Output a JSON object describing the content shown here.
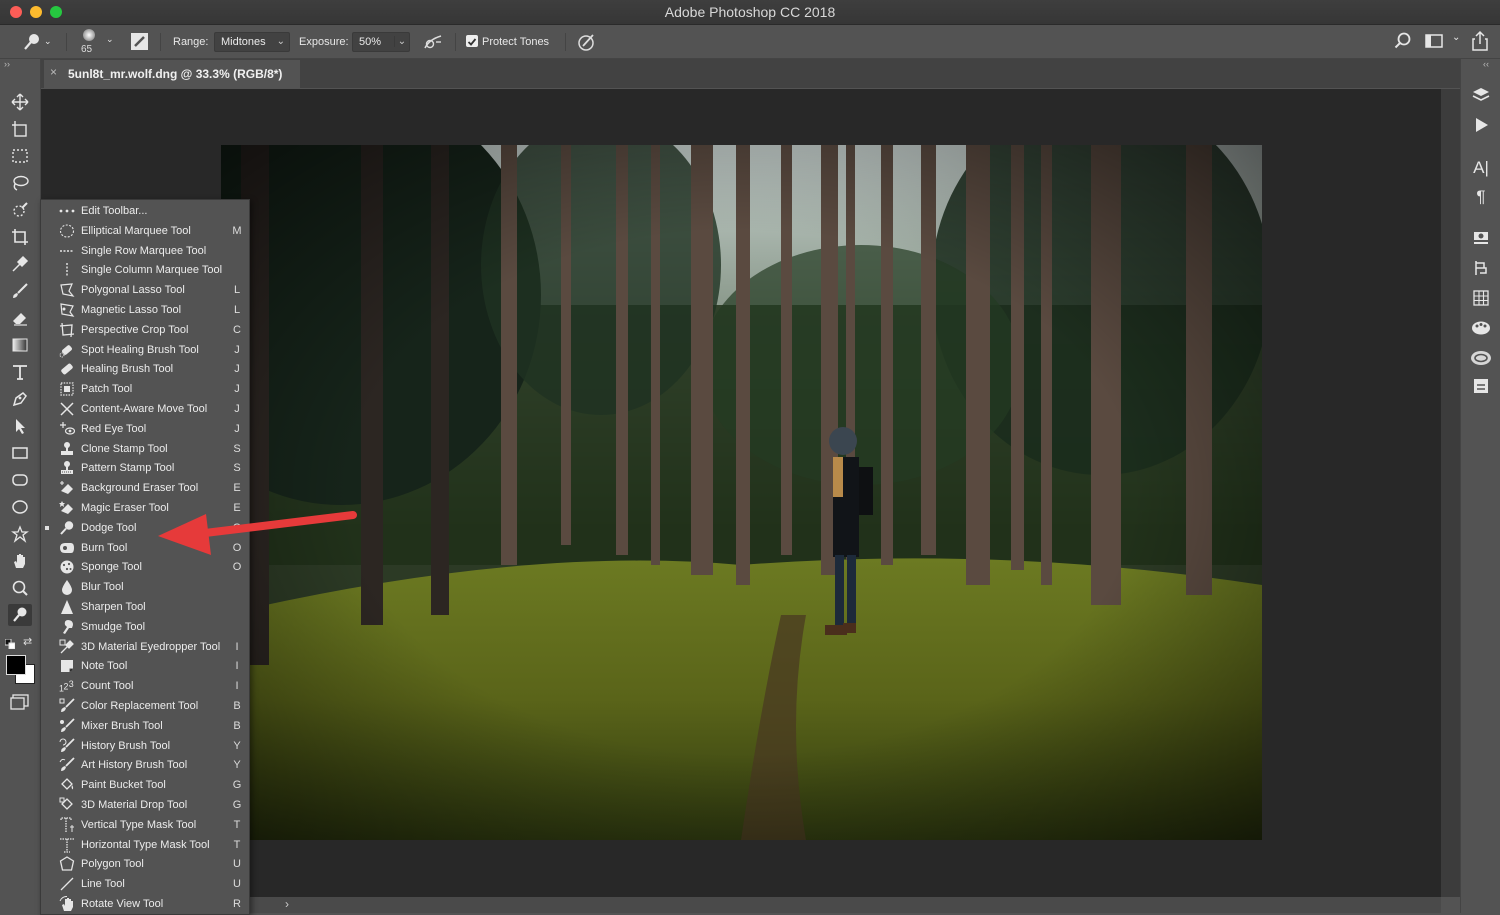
{
  "app": {
    "title": "Adobe Photoshop CC 2018"
  },
  "colors": {
    "traffic_red": "#fc5d57",
    "traffic_yellow": "#fdbb2e",
    "traffic_green": "#26c840",
    "annotation_arrow": "#e63a3a"
  },
  "options_bar": {
    "tool_icon": "dodge-tool-icon",
    "brush_size": "65",
    "range_label": "Range:",
    "range_value": "Midtones",
    "exposure_label": "Exposure:",
    "exposure_value": "50%",
    "protect_tones_label": "Protect Tones",
    "protect_tones_checked": true
  },
  "document": {
    "tab_close": "×",
    "tab_title": "5unl8t_mr.wolf.dng @ 33.3% (RGB/8*)"
  },
  "collapse_left": "››",
  "collapse_right": "‹‹",
  "flyout": {
    "edit_toolbar": "Edit Toolbar...",
    "items": [
      {
        "label": "Elliptical Marquee Tool",
        "key": "M",
        "icon": "elliptical-marquee-icon"
      },
      {
        "label": "Single Row Marquee Tool",
        "key": "",
        "icon": "single-row-marquee-icon"
      },
      {
        "label": "Single Column Marquee Tool",
        "key": "",
        "icon": "single-column-marquee-icon"
      },
      {
        "label": "Polygonal Lasso Tool",
        "key": "L",
        "icon": "polygonal-lasso-icon"
      },
      {
        "label": "Magnetic Lasso Tool",
        "key": "L",
        "icon": "magnetic-lasso-icon"
      },
      {
        "label": "Perspective Crop Tool",
        "key": "C",
        "icon": "perspective-crop-icon"
      },
      {
        "label": "Spot Healing Brush Tool",
        "key": "J",
        "icon": "spot-healing-icon"
      },
      {
        "label": "Healing Brush Tool",
        "key": "J",
        "icon": "healing-brush-icon"
      },
      {
        "label": "Patch Tool",
        "key": "J",
        "icon": "patch-icon"
      },
      {
        "label": "Content-Aware Move Tool",
        "key": "J",
        "icon": "content-aware-move-icon"
      },
      {
        "label": "Red Eye Tool",
        "key": "J",
        "icon": "red-eye-icon"
      },
      {
        "label": "Clone Stamp Tool",
        "key": "S",
        "icon": "clone-stamp-icon"
      },
      {
        "label": "Pattern Stamp Tool",
        "key": "S",
        "icon": "pattern-stamp-icon"
      },
      {
        "label": "Background Eraser Tool",
        "key": "E",
        "icon": "background-eraser-icon"
      },
      {
        "label": "Magic Eraser Tool",
        "key": "E",
        "icon": "magic-eraser-icon"
      },
      {
        "label": "Dodge Tool",
        "key": "O",
        "icon": "dodge-icon",
        "current": true
      },
      {
        "label": "Burn Tool",
        "key": "O",
        "icon": "burn-icon"
      },
      {
        "label": "Sponge Tool",
        "key": "O",
        "icon": "sponge-icon"
      },
      {
        "label": "Blur Tool",
        "key": "",
        "icon": "blur-icon"
      },
      {
        "label": "Sharpen Tool",
        "key": "",
        "icon": "sharpen-icon"
      },
      {
        "label": "Smudge Tool",
        "key": "",
        "icon": "smudge-icon"
      },
      {
        "label": "3D Material Eyedropper Tool",
        "key": "I",
        "icon": "3d-eyedropper-icon"
      },
      {
        "label": "Note Tool",
        "key": "I",
        "icon": "note-icon"
      },
      {
        "label": "Count Tool",
        "key": "I",
        "icon": "count-icon"
      },
      {
        "label": "Color Replacement Tool",
        "key": "B",
        "icon": "color-replacement-icon"
      },
      {
        "label": "Mixer Brush Tool",
        "key": "B",
        "icon": "mixer-brush-icon"
      },
      {
        "label": "History Brush Tool",
        "key": "Y",
        "icon": "history-brush-icon"
      },
      {
        "label": "Art History Brush Tool",
        "key": "Y",
        "icon": "art-history-brush-icon"
      },
      {
        "label": "Paint Bucket Tool",
        "key": "G",
        "icon": "paint-bucket-icon"
      },
      {
        "label": "3D Material Drop Tool",
        "key": "G",
        "icon": "3d-drop-icon"
      },
      {
        "label": "Vertical Type Mask Tool",
        "key": "T",
        "icon": "vertical-type-mask-icon"
      },
      {
        "label": "Horizontal Type Mask Tool",
        "key": "T",
        "icon": "horizontal-type-mask-icon"
      },
      {
        "label": "Polygon Tool",
        "key": "U",
        "icon": "polygon-icon"
      },
      {
        "label": "Line Tool",
        "key": "U",
        "icon": "line-icon"
      },
      {
        "label": "Rotate View Tool",
        "key": "R",
        "icon": "rotate-view-icon"
      }
    ]
  },
  "left_toolbar_icons": [
    "move-icon",
    "artboard-icon",
    "rectangular-marquee-icon",
    "lasso-icon",
    "quick-selection-icon",
    "crop-icon",
    "eyedropper-icon",
    "brush-icon",
    "eraser-icon",
    "gradient-icon",
    "type-icon",
    "pen-icon",
    "path-selection-icon",
    "rectangle-icon",
    "rounded-rectangle-icon",
    "ellipse-icon",
    "custom-shape-icon",
    "hand-icon",
    "zoom-icon",
    "dodge-icon"
  ],
  "right_panel_icons": [
    "layers-icon",
    "actions-play-icon",
    "character-icon",
    "paragraph-icon",
    "adjustments-icon",
    "history-icon",
    "swatches-icon",
    "color-palette-icon",
    "creative-cloud-libraries-icon",
    "properties-icon"
  ],
  "status": {
    "expand_arrow": "›"
  }
}
